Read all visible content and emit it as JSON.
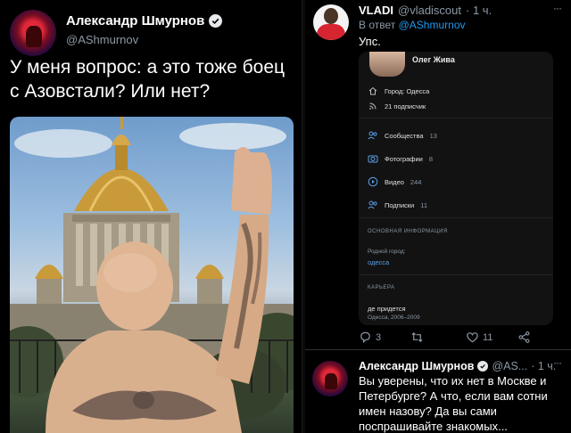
{
  "left_tweet": {
    "author_name": "Александр Шмурнов",
    "handle": "@AShmurnov",
    "text": "У меня вопрос: а это тоже боец с Азовстали? Или нет?",
    "image": "photo-man-raised-hand-cathedral"
  },
  "reply_tweet": {
    "author_name": "VLADI",
    "handle": "@vladiscout",
    "time": "· 1 ч.",
    "more": "···",
    "reply_prefix": "В ответ",
    "reply_mention": "@AShmurnov",
    "text": "Упс.",
    "profile_card": {
      "name": "Олег Жива",
      "city": "Город: Одесса",
      "followers": "21 подписчик",
      "communities_label": "Сообщества",
      "communities_count": "13",
      "photos_label": "Фотографии",
      "photos_count": "8",
      "videos_label": "Видео",
      "videos_count": "244",
      "subscriptions_label": "Подписки",
      "subscriptions_count": "11",
      "main_info_header": "ОСНОВНАЯ ИНФОРМАЦИЯ",
      "hometown_label": "Родной город:",
      "hometown_value": "одесса",
      "career_header": "КАРЬЕРА",
      "career_place": "де придется",
      "career_period": "Одесса, 2006–2009"
    },
    "actions": {
      "replies": "3",
      "retweets": "",
      "likes": "11"
    }
  },
  "second_reply": {
    "author_name": "Александр Шмурнов",
    "handle": "@AS...",
    "time": "· 1 ч.",
    "more": "···",
    "text": "Вы уверены, что их нет в Москве и Петербурге? А что, если вам сотни имен назову? Да вы сами поспрашивайте знакомых..."
  },
  "colors": {
    "background": "#000000",
    "accent": "#1d9bf0",
    "muted": "#8b98a5",
    "card": "#121212"
  }
}
